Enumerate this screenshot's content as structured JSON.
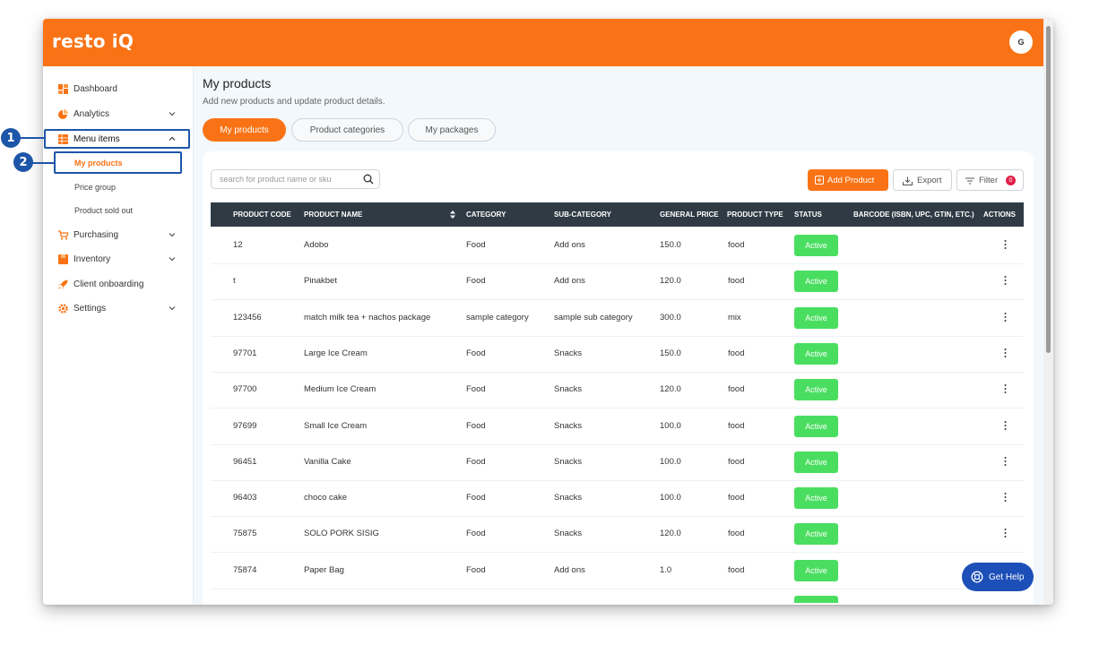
{
  "app": {
    "logo": "resto iQ",
    "avatar_initial": "G"
  },
  "colors": {
    "brand": "#f97316",
    "status_active": "#4ade60",
    "annotation": "#1d56a8",
    "header_dark": "#2f3a44"
  },
  "annotations": [
    {
      "label": "1"
    },
    {
      "label": "2"
    }
  ],
  "sidebar": {
    "items": [
      {
        "label": "Dashboard",
        "icon": "dashboard-icon"
      },
      {
        "label": "Analytics",
        "icon": "pie-chart-icon",
        "expandable": true
      },
      {
        "label": "Menu items",
        "icon": "menu-grid-icon",
        "expandable": true,
        "expanded": true
      },
      {
        "label": "Purchasing",
        "icon": "cart-icon",
        "expandable": true
      },
      {
        "label": "Inventory",
        "icon": "box-icon",
        "expandable": true
      },
      {
        "label": "Client onboarding",
        "icon": "rocket-icon"
      },
      {
        "label": "Settings",
        "icon": "gear-icon",
        "expandable": true
      }
    ],
    "sub_items": [
      {
        "label": "My products",
        "active": true
      },
      {
        "label": "Price group"
      },
      {
        "label": "Product sold out"
      }
    ]
  },
  "main": {
    "title": "My products",
    "subtitle": "Add new products and update product details.",
    "tabs": [
      {
        "label": "My products",
        "active": true
      },
      {
        "label": "Product categories"
      },
      {
        "label": "My packages"
      }
    ],
    "search": {
      "placeholder": "search for product name or sku"
    },
    "actions": {
      "add": "Add Product",
      "export": "Export",
      "filter": "Filter",
      "filter_count": "0"
    },
    "table": {
      "columns": [
        "PRODUCT CODE",
        "PRODUCT NAME",
        "CATEGORY",
        "SUB-CATEGORY",
        "GENERAL PRICE",
        "PRODUCT TYPE",
        "STATUS",
        "BARCODE (ISBN, UPC, GTIN, ETC.)",
        "ACTIONS"
      ],
      "rows": [
        {
          "code": "12",
          "name": "Adobo",
          "category": "Food",
          "sub": "Add ons",
          "price": "150.0",
          "type": "food",
          "status": "Active"
        },
        {
          "code": "t",
          "name": "Pinakbet",
          "category": "Food",
          "sub": "Add ons",
          "price": "120.0",
          "type": "food",
          "status": "Active"
        },
        {
          "code": "123456",
          "name": "match milk tea + nachos package",
          "category": "sample category",
          "sub": "sample sub category",
          "price": "300.0",
          "type": "mix",
          "status": "Active"
        },
        {
          "code": "97701",
          "name": "Large Ice Cream",
          "category": "Food",
          "sub": "Snacks",
          "price": "150.0",
          "type": "food",
          "status": "Active"
        },
        {
          "code": "97700",
          "name": "Medium Ice Cream",
          "category": "Food",
          "sub": "Snacks",
          "price": "120.0",
          "type": "food",
          "status": "Active"
        },
        {
          "code": "97699",
          "name": "Small Ice Cream",
          "category": "Food",
          "sub": "Snacks",
          "price": "100.0",
          "type": "food",
          "status": "Active"
        },
        {
          "code": "96451",
          "name": "Vanilla Cake",
          "category": "Food",
          "sub": "Snacks",
          "price": "100.0",
          "type": "food",
          "status": "Active"
        },
        {
          "code": "96403",
          "name": "choco cake",
          "category": "Food",
          "sub": "Snacks",
          "price": "100.0",
          "type": "food",
          "status": "Active"
        },
        {
          "code": "75875",
          "name": "SOLO PORK SISIG",
          "category": "Food",
          "sub": "Snacks",
          "price": "120.0",
          "type": "food",
          "status": "Active"
        },
        {
          "code": "75874",
          "name": "Paper Bag",
          "category": "Food",
          "sub": "Add ons",
          "price": "1.0",
          "type": "food",
          "status": "Active"
        }
      ]
    }
  },
  "help": {
    "label": "Get Help"
  }
}
